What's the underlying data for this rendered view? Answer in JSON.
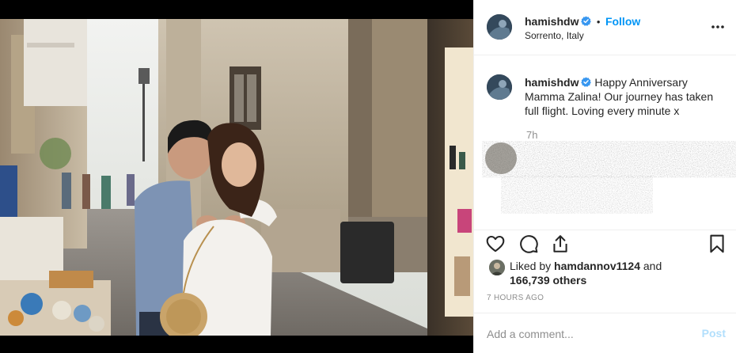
{
  "post": {
    "username": "hamishdw",
    "location": "Sorrento, Italy",
    "follow_label": "Follow",
    "dot_separator": "•",
    "caption": "Happy Anniversary Mamma Zalina! Our journey has taken full flight. Loving every minute x",
    "caption_age": "7h"
  },
  "likes": {
    "prefix": "Liked by ",
    "user": "hamdannov1124",
    "middle": " and",
    "count": "166,739 others"
  },
  "timestamp": "7 HOURS AGO",
  "comment": {
    "placeholder": "Add a comment...",
    "post_label": "Post"
  },
  "icons": {
    "verified": "verified-badge-icon",
    "more": "more-options-icon",
    "like": "heart-icon",
    "comment": "comment-bubble-icon",
    "share": "share-icon",
    "save": "bookmark-icon"
  },
  "colors": {
    "accent": "#0095f6",
    "post_disabled": "#b2dffc",
    "muted": "#8e8e8e",
    "text": "#262626"
  }
}
